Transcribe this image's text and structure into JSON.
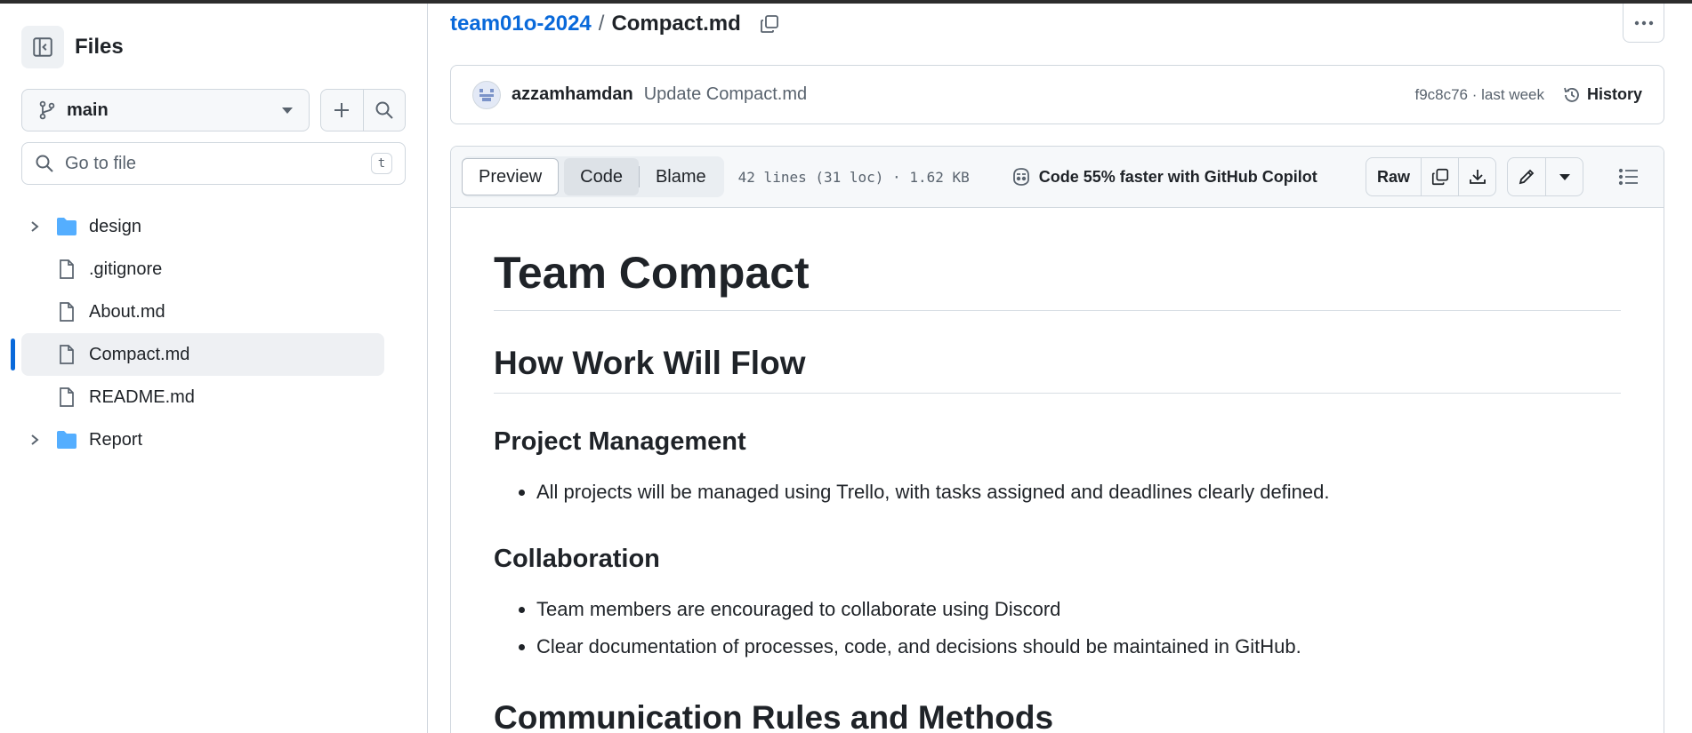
{
  "sidebar": {
    "title": "Files",
    "branch": "main",
    "goto_placeholder": "Go to file",
    "goto_shortcut": "t",
    "tree": [
      {
        "type": "folder",
        "label": "design",
        "icon": "folder-icon"
      },
      {
        "type": "file",
        "label": ".gitignore",
        "icon": "file-icon"
      },
      {
        "type": "file",
        "label": "About.md",
        "icon": "file-icon"
      },
      {
        "type": "file",
        "label": "Compact.md",
        "icon": "file-icon",
        "active": true
      },
      {
        "type": "file",
        "label": "README.md",
        "icon": "file-icon"
      },
      {
        "type": "folder",
        "label": "Report",
        "icon": "folder-icon"
      }
    ]
  },
  "breadcrumb": {
    "repo": "team01o-2024",
    "separator": "/",
    "file": "Compact.md"
  },
  "commit": {
    "author": "azzamhamdan",
    "message": "Update Compact.md",
    "meta": "f9c8c76 · last week",
    "history_label": "History"
  },
  "toolbar": {
    "tabs": [
      "Preview",
      "Code",
      "Blame"
    ],
    "file_info": "42 lines (31 loc) · 1.62 KB",
    "copilot": "Code 55% faster with GitHub Copilot",
    "raw_label": "Raw"
  },
  "markdown": {
    "h1": "Team Compact",
    "h2_1": "How Work Will Flow",
    "h3_1": "Project Management",
    "pm_items": [
      "All projects will be managed using Trello, with tasks assigned and deadlines clearly defined."
    ],
    "h3_2": "Collaboration",
    "collab_items": [
      "Team members are encouraged to collaborate using Discord",
      "Clear documentation of processes, code, and decisions should be maintained in GitHub."
    ],
    "h2_2": "Communication Rules and Methods"
  },
  "colors": {
    "accent": "#0969da",
    "folder": "#54aeff",
    "border": "#d0d7de",
    "muted": "#59636e"
  }
}
